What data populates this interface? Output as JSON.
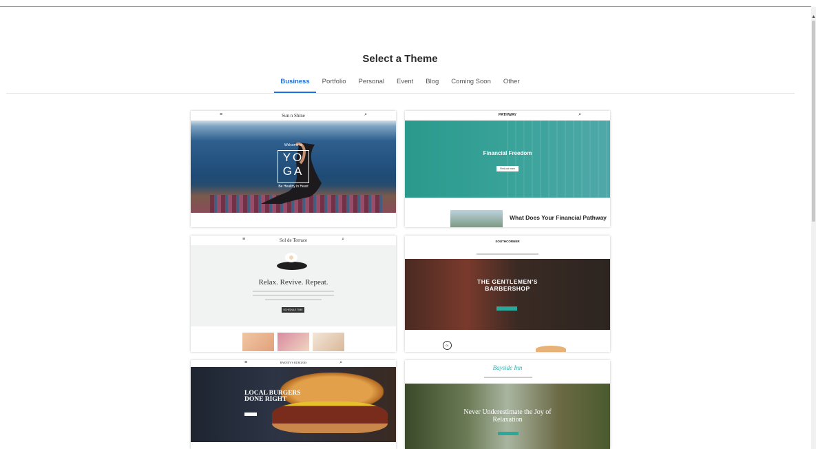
{
  "page": {
    "title": "Select a Theme"
  },
  "tabs": [
    "Business",
    "Portfolio",
    "Personal",
    "Event",
    "Blog",
    "Coming Soon",
    "Other"
  ],
  "active_tab": "Business",
  "themes": [
    {
      "brand": "Sun n Shine",
      "headline_line1": "YO",
      "headline_line2": "GA",
      "kicker": "Welcome to",
      "tagline": "Be Healthy in Heart"
    },
    {
      "brand": "PATHWAY",
      "headline": "Financial Freedom",
      "button": "Find out more",
      "subheading": "What Does Your Financial Pathway"
    },
    {
      "brand": "Sol de Terrace",
      "headline": "Relax. Revive. Repeat.",
      "button": "SCHEDULE TIME"
    },
    {
      "brand": "SOUTHCORNER",
      "headline_line1": "THE GENTLEMEN'S",
      "headline_line2": "BARBERSHOP"
    },
    {
      "brand": "BARNEY'S BURGERS",
      "headline_line1": "LOCAL BURGERS",
      "headline_line2": "DONE RIGHT"
    },
    {
      "brand": "Bayside Inn",
      "headline_line1": "Never Underestimate the Joy of",
      "headline_line2": "Relaxation"
    }
  ],
  "colors": {
    "accent": "#1f6fd6",
    "teal": "#2aa89a"
  }
}
